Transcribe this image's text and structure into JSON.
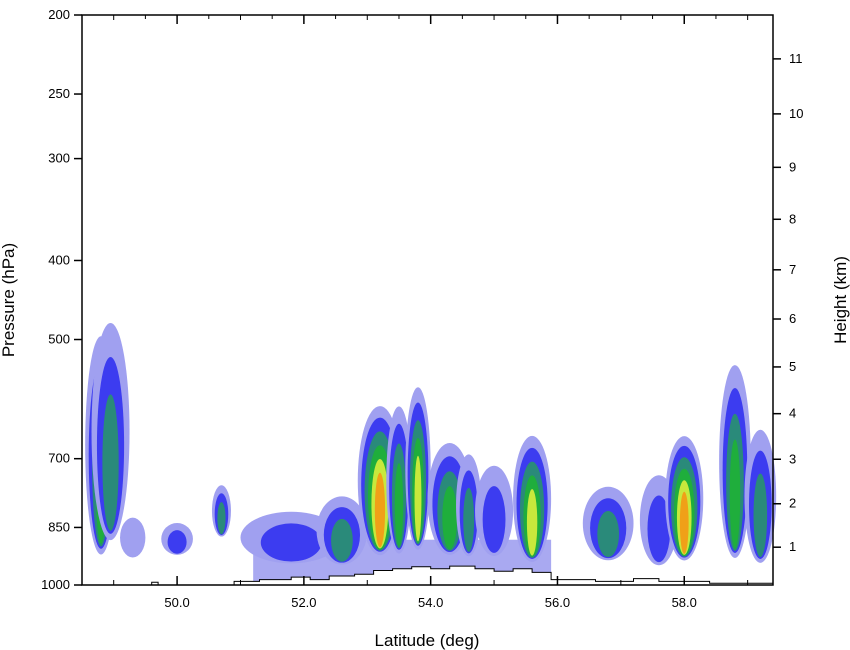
{
  "chart_data": {
    "type": "heatmap",
    "xlabel": "Latitude (deg)",
    "ylabel_left": "Pressure (hPa)",
    "ylabel_right": "Height (km)",
    "x_range": [
      48.5,
      59.4
    ],
    "x_ticks": [
      "50.0",
      "52.0",
      "54.0",
      "56.0",
      "58.0"
    ],
    "x_tick_values": [
      50,
      52,
      54,
      56,
      58
    ],
    "pressure_range": [
      1000,
      200
    ],
    "pressure_scale": "log",
    "pressure_ticks": [
      "200",
      "250",
      "300",
      "400",
      "500",
      "700",
      "850",
      "1000"
    ],
    "pressure_tick_values": [
      200,
      250,
      300,
      400,
      500,
      700,
      850,
      1000
    ],
    "height_ticks": [
      "1",
      "2",
      "3",
      "4",
      "5",
      "6",
      "7",
      "8",
      "9",
      "10",
      "11"
    ],
    "height_tick_values": [
      1,
      2,
      3,
      4,
      5,
      6,
      7,
      8,
      9,
      10,
      11
    ],
    "levels": [
      {
        "color": "#a0a0f0",
        "note": "outer"
      },
      {
        "color": "#3c3cf0"
      },
      {
        "color": "#2a8a7a"
      },
      {
        "color": "#1fae3c"
      },
      {
        "color": "#c8e83c"
      },
      {
        "color": "#f0a018"
      },
      {
        "color": "#e03c3c"
      }
    ],
    "cells": [
      {
        "lat": 48.8,
        "p_top": 540,
        "p_bot": 1000,
        "w": 0.25,
        "max": 4
      },
      {
        "lat": 48.95,
        "p_top": 520,
        "p_bot": 960,
        "w": 0.3,
        "max": 3
      },
      {
        "lat": 49.3,
        "p_top": 840,
        "p_bot": 940,
        "w": 0.2,
        "max": 1
      },
      {
        "lat": 50.0,
        "p_top": 850,
        "p_bot": 930,
        "w": 0.25,
        "max": 2
      },
      {
        "lat": 50.7,
        "p_top": 770,
        "p_bot": 890,
        "w": 0.15,
        "max": 3
      },
      {
        "lat": 51.8,
        "p_top": 830,
        "p_bot": 960,
        "w": 0.8,
        "max": 2
      },
      {
        "lat": 52.6,
        "p_top": 800,
        "p_bot": 970,
        "w": 0.4,
        "max": 3
      },
      {
        "lat": 53.2,
        "p_top": 640,
        "p_bot": 975,
        "w": 0.35,
        "max": 6
      },
      {
        "lat": 53.5,
        "p_top": 640,
        "p_bot": 970,
        "w": 0.2,
        "max": 4
      },
      {
        "lat": 53.8,
        "p_top": 610,
        "p_bot": 965,
        "w": 0.2,
        "max": 5
      },
      {
        "lat": 54.3,
        "p_top": 700,
        "p_bot": 960,
        "w": 0.35,
        "max": 4
      },
      {
        "lat": 54.6,
        "p_top": 720,
        "p_bot": 960,
        "w": 0.2,
        "max": 3
      },
      {
        "lat": 55.0,
        "p_top": 740,
        "p_bot": 955,
        "w": 0.3,
        "max": 2
      },
      {
        "lat": 55.6,
        "p_top": 690,
        "p_bot": 985,
        "w": 0.3,
        "max": 5
      },
      {
        "lat": 56.8,
        "p_top": 780,
        "p_bot": 960,
        "w": 0.4,
        "max": 3
      },
      {
        "lat": 57.6,
        "p_top": 760,
        "p_bot": 980,
        "w": 0.3,
        "max": 2
      },
      {
        "lat": 58.0,
        "p_top": 690,
        "p_bot": 980,
        "w": 0.3,
        "max": 6
      },
      {
        "lat": 58.8,
        "p_top": 580,
        "p_bot": 1000,
        "w": 0.25,
        "max": 4
      },
      {
        "lat": 59.2,
        "p_top": 680,
        "p_bot": 990,
        "w": 0.25,
        "max": 3
      }
    ]
  }
}
